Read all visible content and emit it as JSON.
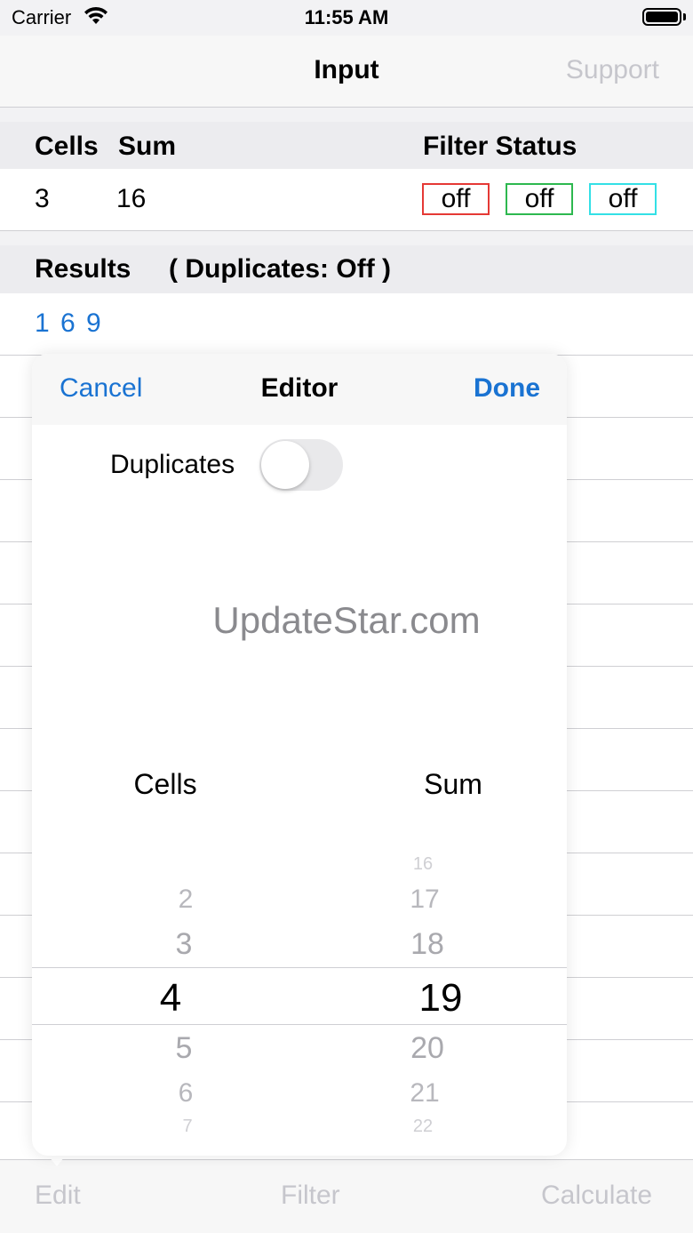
{
  "status_bar": {
    "carrier": "Carrier",
    "time": "11:55 AM"
  },
  "nav": {
    "title": "Input",
    "support_label": "Support"
  },
  "table": {
    "headers": {
      "cells": "Cells",
      "sum": "Sum",
      "filter_status": "Filter Status"
    },
    "row": {
      "cells": "3",
      "sum": "16"
    },
    "filters": [
      {
        "label": "off",
        "color": "#e53935"
      },
      {
        "label": "off",
        "color": "#2db84f"
      },
      {
        "label": "off",
        "color": "#33e0e6"
      }
    ]
  },
  "results": {
    "title": "Results",
    "duplicates_label": "( Duplicates:  Off )",
    "values": "1 6 9"
  },
  "tabs": {
    "edit": "Edit",
    "filter": "Filter",
    "calculate": "Calculate"
  },
  "editor": {
    "cancel_label": "Cancel",
    "title": "Editor",
    "done_label": "Done",
    "duplicates_label": "Duplicates",
    "duplicates_on": false,
    "watermark": "UpdateStar.com",
    "picker": {
      "cells_label": "Cells",
      "sum_label": "Sum",
      "cells_options": [
        "2",
        "3",
        "4",
        "5",
        "6",
        "7"
      ],
      "cells_selected": "4",
      "sum_options": [
        "16",
        "17",
        "18",
        "19",
        "20",
        "21",
        "22"
      ],
      "sum_selected": "19"
    }
  },
  "colors": {
    "accent": "#1a73d2",
    "disabled": "#c6c6cc"
  }
}
